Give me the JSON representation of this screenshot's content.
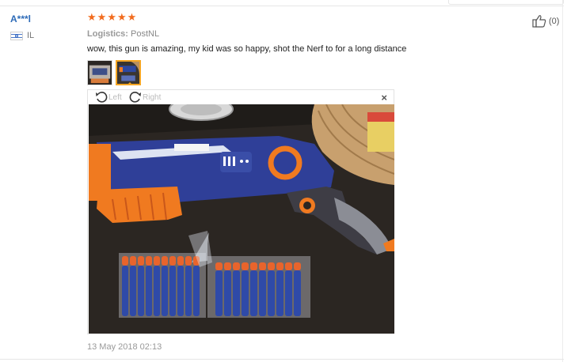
{
  "reviewer": {
    "name": "A***l",
    "country": "IL"
  },
  "review": {
    "rating": 5,
    "logistics_label": "Logistics:",
    "logistics_value": "PostNL",
    "text": "wow, this gun is amazing, my kid was so happy, shot the Nerf to for a long distance",
    "date": "13 May 2018 02:13"
  },
  "viewer": {
    "rotate_left_label": "Left",
    "rotate_right_label": "Right",
    "close_label": "×"
  },
  "helpful": {
    "count_label": "(0)"
  },
  "icons": {
    "star": "star-icon",
    "flag": "israel-flag-icon",
    "rotate_left": "rotate-left-icon",
    "rotate_right": "rotate-right-icon",
    "close": "close-icon",
    "thumbs_up": "thumbs-up-icon"
  },
  "colors": {
    "star": "#f26b1d",
    "username": "#2d6bb8",
    "thumb_active": "#f5a623"
  }
}
